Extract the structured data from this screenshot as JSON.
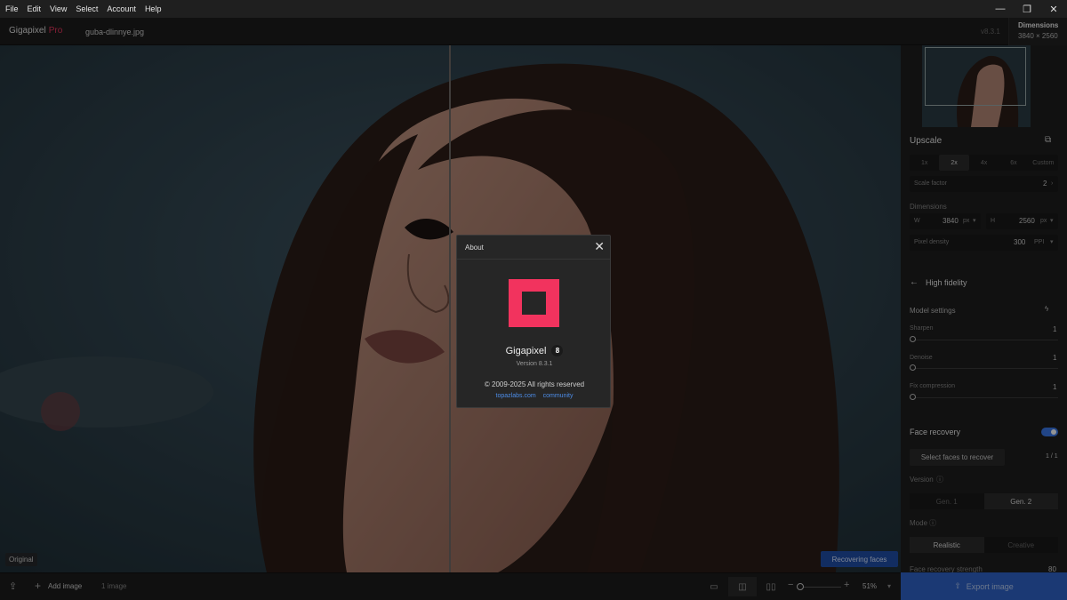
{
  "menu": [
    "File",
    "Edit",
    "View",
    "Select",
    "Account",
    "Help"
  ],
  "window_controls": {
    "minimize": "—",
    "restore": "❐",
    "close": "✕"
  },
  "app": {
    "name": "Gigapixel",
    "edition": "Pro",
    "filename": "guba-dlinnye.jpg",
    "version": "v8.3.1"
  },
  "dimensions_box": {
    "title": "Dimensions",
    "value": "3840 × 2560"
  },
  "canvas": {
    "original_label": "Original",
    "status": "Recovering faces"
  },
  "sidebar": {
    "upscale": {
      "title": "Upscale",
      "scales": [
        "1x",
        "2x",
        "4x",
        "6x",
        "Custom"
      ],
      "active_scale": "2x",
      "scale_factor_label": "Scale factor",
      "scale_factor_value": "2",
      "dimensions_label": "Dimensions",
      "w_label": "W",
      "w_value": "3840",
      "w_unit": "px",
      "h_label": "H",
      "h_value": "2560",
      "h_unit": "px",
      "pixel_density_label": "Pixel density",
      "pixel_density_value": "300",
      "pixel_density_unit": "PPI"
    },
    "model": {
      "back_title": "High fidelity",
      "settings_label": "Model settings",
      "sharpen_label": "Sharpen",
      "sharpen_value": "1",
      "denoise_label": "Denoise",
      "denoise_value": "1",
      "fix_label": "Fix compression",
      "fix_value": "1"
    },
    "face": {
      "title": "Face recovery",
      "select_button": "Select faces to recover",
      "count": "1 / 1",
      "version_label": "Version",
      "gen1": "Gen. 1",
      "gen2": "Gen. 2",
      "mode_label": "Mode",
      "realistic": "Realistic",
      "creative": "Creative",
      "strength_label": "Face recovery strength",
      "strength_value": "80"
    }
  },
  "bottom": {
    "add_image": "Add image",
    "image_count": "1 image",
    "zoom": "51%",
    "export": "Export image"
  },
  "about": {
    "title": "About",
    "product": "Gigapixel",
    "badge": "8",
    "version": "Version 8.3.1",
    "copyright": "© 2009-2025 All rights reserved",
    "link1": "topazlabs.com",
    "link2": "community"
  },
  "colors": {
    "brand_pink": "#f2335e",
    "accent_blue": "#2f62c9"
  },
  "icons": [
    "minimize-icon",
    "restore-icon",
    "close-icon",
    "crop-icon",
    "back-arrow-icon",
    "lightning-icon",
    "info-icon",
    "upload-icon",
    "plus-icon",
    "single-view-icon",
    "split-view-icon",
    "side-by-side-icon",
    "zoom-out-icon",
    "zoom-in-icon",
    "chevron-down-icon",
    "export-icon"
  ]
}
